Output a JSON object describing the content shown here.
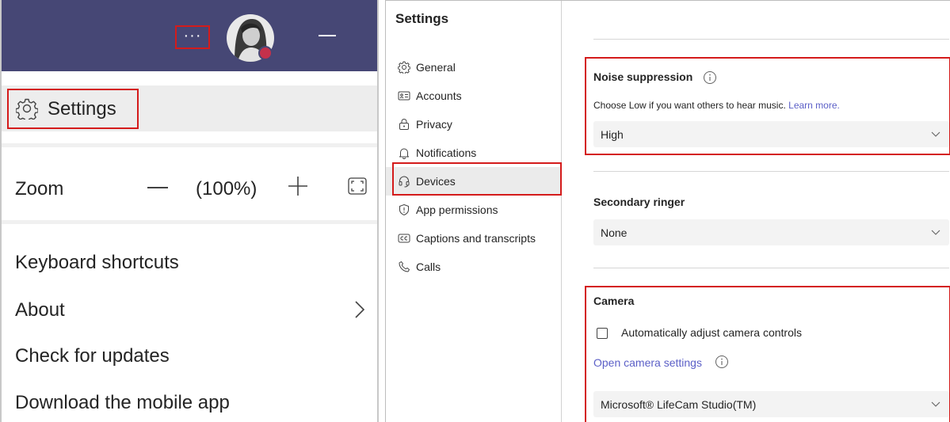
{
  "left_menu": {
    "title_bar": {
      "more_options_label": "···",
      "avatar_status_color": "#c4314b",
      "bar_color": "#464775"
    },
    "settings_label": "Settings",
    "zoom": {
      "label": "Zoom",
      "value": "(100%)"
    },
    "items": [
      {
        "label": "Keyboard shortcuts"
      },
      {
        "label": "About"
      },
      {
        "label": "Check for updates"
      },
      {
        "label": "Download the mobile app"
      }
    ]
  },
  "settings_window": {
    "title": "Settings",
    "nav": [
      {
        "label": "General",
        "icon": "gear-icon"
      },
      {
        "label": "Accounts",
        "icon": "id-card-icon"
      },
      {
        "label": "Privacy",
        "icon": "lock-icon"
      },
      {
        "label": "Notifications",
        "icon": "bell-icon"
      },
      {
        "label": "Devices",
        "icon": "headset-icon",
        "active": true
      },
      {
        "label": "App permissions",
        "icon": "shield-icon"
      },
      {
        "label": "Captions and transcripts",
        "icon": "cc-icon"
      },
      {
        "label": "Calls",
        "icon": "phone-icon"
      }
    ],
    "noise_suppression": {
      "title": "Noise suppression",
      "help_text": "Choose Low if you want others to hear music.",
      "help_link": "Learn more.",
      "value": "High"
    },
    "secondary_ringer": {
      "title": "Secondary ringer",
      "value": "None"
    },
    "camera": {
      "title": "Camera",
      "auto_adjust_label": "Automatically adjust camera controls",
      "auto_adjust_checked": false,
      "open_settings_label": "Open camera settings",
      "value": "Microsoft® LifeCam Studio(TM)"
    }
  },
  "colors": {
    "highlight_border": "#d41b1b",
    "link": "#5b5fc7"
  }
}
